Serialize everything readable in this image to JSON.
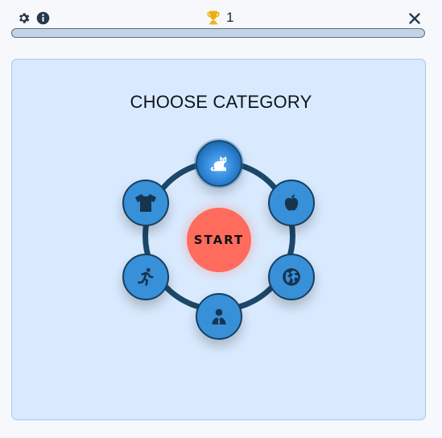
{
  "header": {
    "score": "1",
    "icons": {
      "settings": "gear-icon",
      "info": "info-icon",
      "score": "trophy-icon",
      "close": "close-icon"
    },
    "progress_fraction": 0.0
  },
  "main": {
    "title": "CHOOSE CATEGORY",
    "start_label": "START",
    "categories": [
      {
        "icon": "cat-icon",
        "selected": true
      },
      {
        "icon": "apple-icon",
        "selected": false
      },
      {
        "icon": "globe-icon",
        "selected": false
      },
      {
        "icon": "person-icon",
        "selected": false
      },
      {
        "icon": "running-icon",
        "selected": false
      },
      {
        "icon": "tshirt-icon",
        "selected": false
      }
    ]
  },
  "colors": {
    "accent": "#3790d8",
    "ring": "#1c4869",
    "start": "#ff6b5c",
    "trophy": "#f0ad10",
    "panel": "#d9eafe"
  }
}
